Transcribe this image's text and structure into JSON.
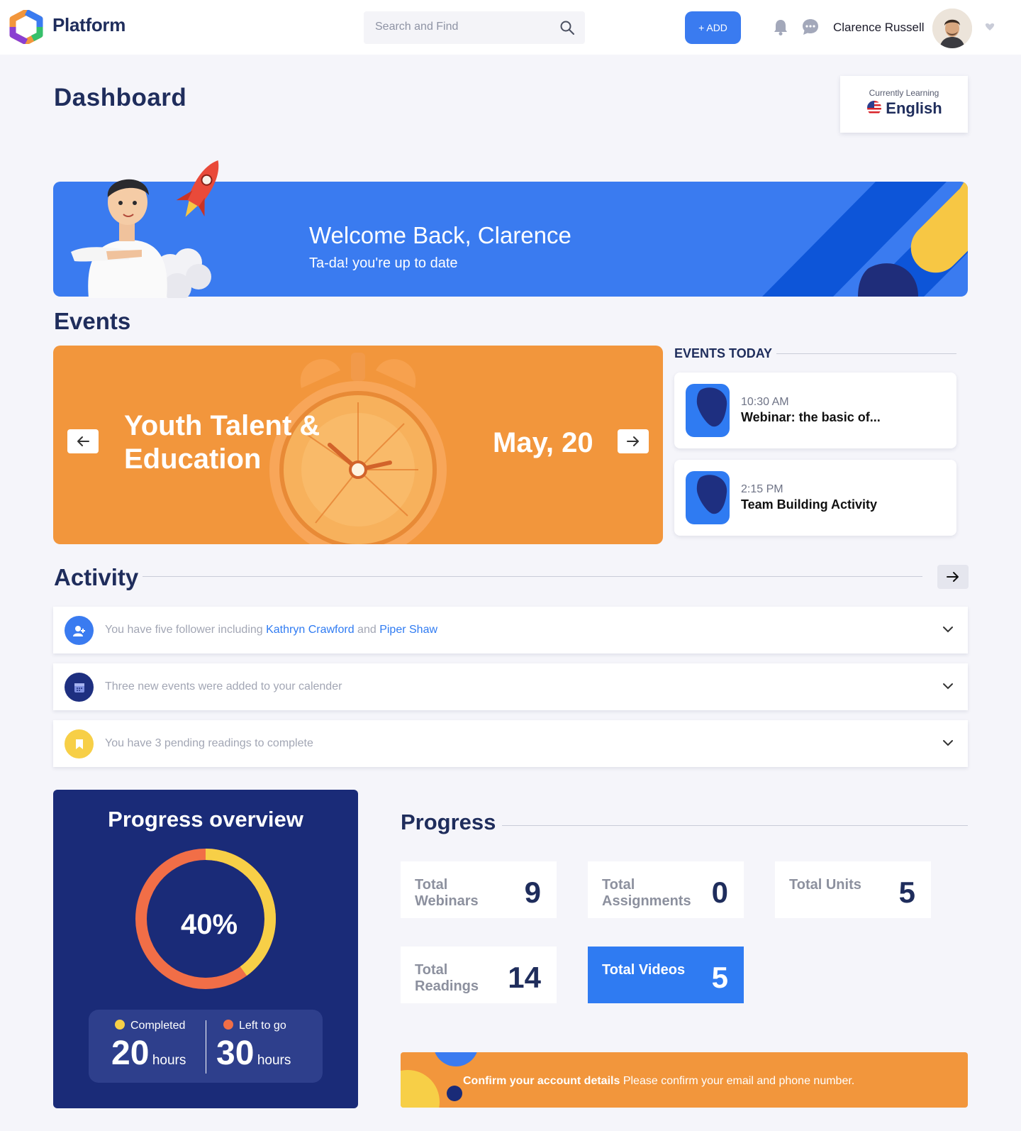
{
  "header": {
    "brand": "Platform",
    "search_placeholder": "Search and Find",
    "add_label": "+ ADD",
    "user_name": "Clarence Russell"
  },
  "page_title": "Dashboard",
  "language": {
    "caption": "Currently Learning",
    "value": "English"
  },
  "welcome": {
    "title": "Welcome Back, Clarence",
    "subtitle": "Ta-da! you're up to date"
  },
  "events": {
    "heading": "Events",
    "featured": {
      "title": "Youth Talent & Education",
      "date": "May, 20"
    },
    "today_heading": "EVENTS TODAY",
    "today": [
      {
        "time": "10:30 AM",
        "name": "Webinar: the basic of..."
      },
      {
        "time": "2:15 PM",
        "name": "Team Building Activity"
      }
    ]
  },
  "activity": {
    "heading": "Activity",
    "items": [
      {
        "pre": "You have five follower including ",
        "link1": "Kathryn Crawford",
        "mid": " and ",
        "link2": "Piper Shaw"
      },
      {
        "text": "Three new events were added to your calender"
      },
      {
        "text": "You have 3 pending readings to complete"
      }
    ]
  },
  "progress_overview": {
    "title": "Progress overview",
    "percent_label": "40%",
    "percent_value": 40,
    "completed_label": "Completed",
    "completed_value": "20",
    "left_label": "Left to go",
    "left_value": "30",
    "unit": "hours",
    "colors": {
      "completed": "#f7cf47",
      "left": "#f16e47"
    }
  },
  "progress": {
    "heading": "Progress",
    "stats": [
      {
        "label": "Total Webinars",
        "value": "9"
      },
      {
        "label": "Total Assignments",
        "value": "0"
      },
      {
        "label": "Total Units",
        "value": "5"
      },
      {
        "label": "Total Readings",
        "value": "14"
      },
      {
        "label": "Total Videos",
        "value": "5"
      }
    ]
  },
  "confirm": {
    "bold": "Confirm your account details",
    "text": " Please confirm your email and phone number."
  },
  "colors": {
    "primary": "#3a7bf0",
    "navy": "#1a2b78",
    "orange": "#f2963c",
    "yellow": "#f7cf47"
  }
}
